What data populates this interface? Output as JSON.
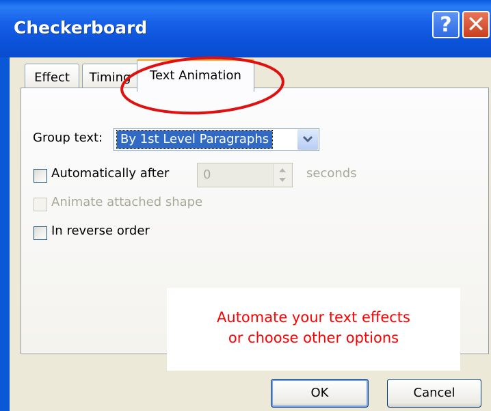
{
  "window": {
    "title": "Checkerboard",
    "help_glyph": "?",
    "close_glyph": "✕"
  },
  "tabs": [
    {
      "label": "Effect",
      "selected": false
    },
    {
      "label": "Timing",
      "selected": false
    },
    {
      "label": "Text Animation",
      "selected": true
    }
  ],
  "group_text": {
    "label": "Group text:",
    "value": "By 1st Level Paragraphs"
  },
  "auto_after": {
    "label": "Automatically after",
    "checked": false,
    "value": "0",
    "unit": "seconds"
  },
  "animate_shape": {
    "label": "Animate attached shape",
    "checked": false,
    "enabled": false
  },
  "reverse_order": {
    "label": "In reverse order",
    "checked": false
  },
  "callout": {
    "line1": "Automate your text effects",
    "line2": "or choose other options",
    "color": "#ff0000"
  },
  "buttons": {
    "ok": "OK",
    "cancel": "Cancel"
  },
  "colors": {
    "title_bar": "#0a58d6",
    "dialog_bg": "#ece9d8",
    "selection": "#316ac5",
    "annotation": "#e01010"
  }
}
